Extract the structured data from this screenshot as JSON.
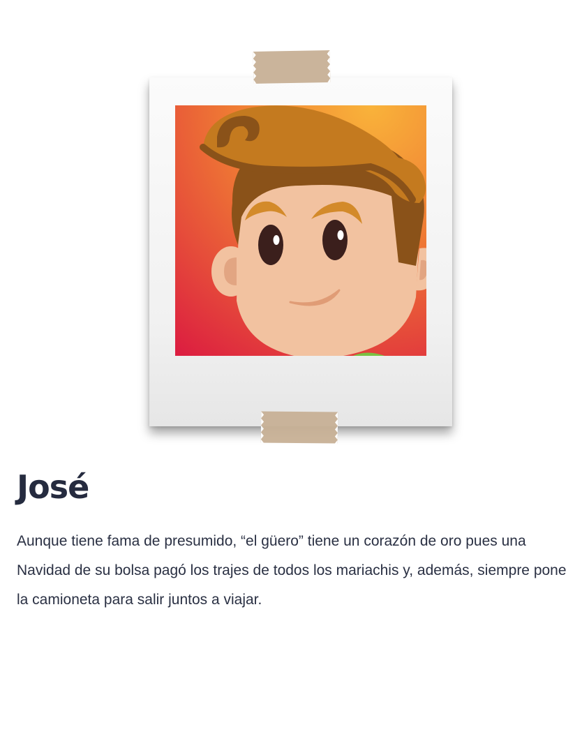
{
  "character": {
    "name": "José",
    "description": "Aunque tiene fama de presumido, “el güero” tiene un corazón de oro pues una Navidad de su bolsa pagó los trajes de todos los mariachis y, además, siempre pone la camioneta para salir juntos a viajar."
  },
  "colors": {
    "title": "#252b3f",
    "text": "#2a3043",
    "tape": "#c8b196",
    "photo_background_top": "#f7a93a",
    "photo_background_bottom": "#dd1f3f",
    "hair": "#c47a1f",
    "skin": "#f2c2a0"
  },
  "icons": {
    "portrait": "cartoon-boy-portrait"
  }
}
